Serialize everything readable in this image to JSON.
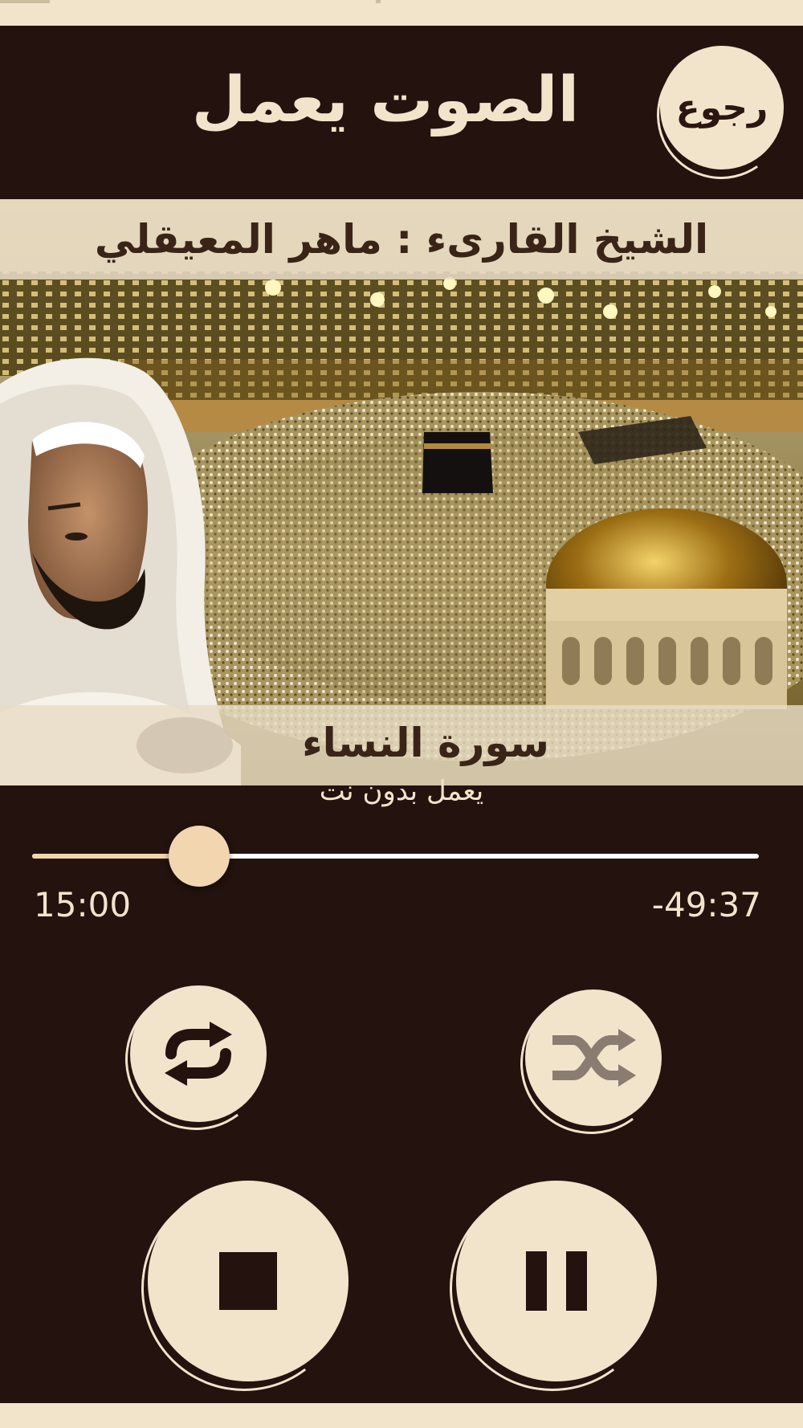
{
  "header": {
    "back_label": "رجوع",
    "title": "الصوت يعمل"
  },
  "artwork": {
    "reciter": "الشيخ القارىء : ماهر المعيقلي",
    "surah": "سورة النساء"
  },
  "player": {
    "offline_label": "يعمل بدون نت",
    "elapsed": "15:00",
    "remaining": "-49:37",
    "progress_fraction": 0.23
  },
  "controls": {
    "repeat_icon": "repeat-icon",
    "shuffle_icon": "shuffle-icon",
    "stop_icon": "stop-icon",
    "pause_icon": "pause-icon"
  },
  "colors": {
    "background": "#23120e",
    "button": "#f1e4cb",
    "accent": "#f1d6b0",
    "icon": "#23120e",
    "icon_muted": "#8a7c70"
  }
}
